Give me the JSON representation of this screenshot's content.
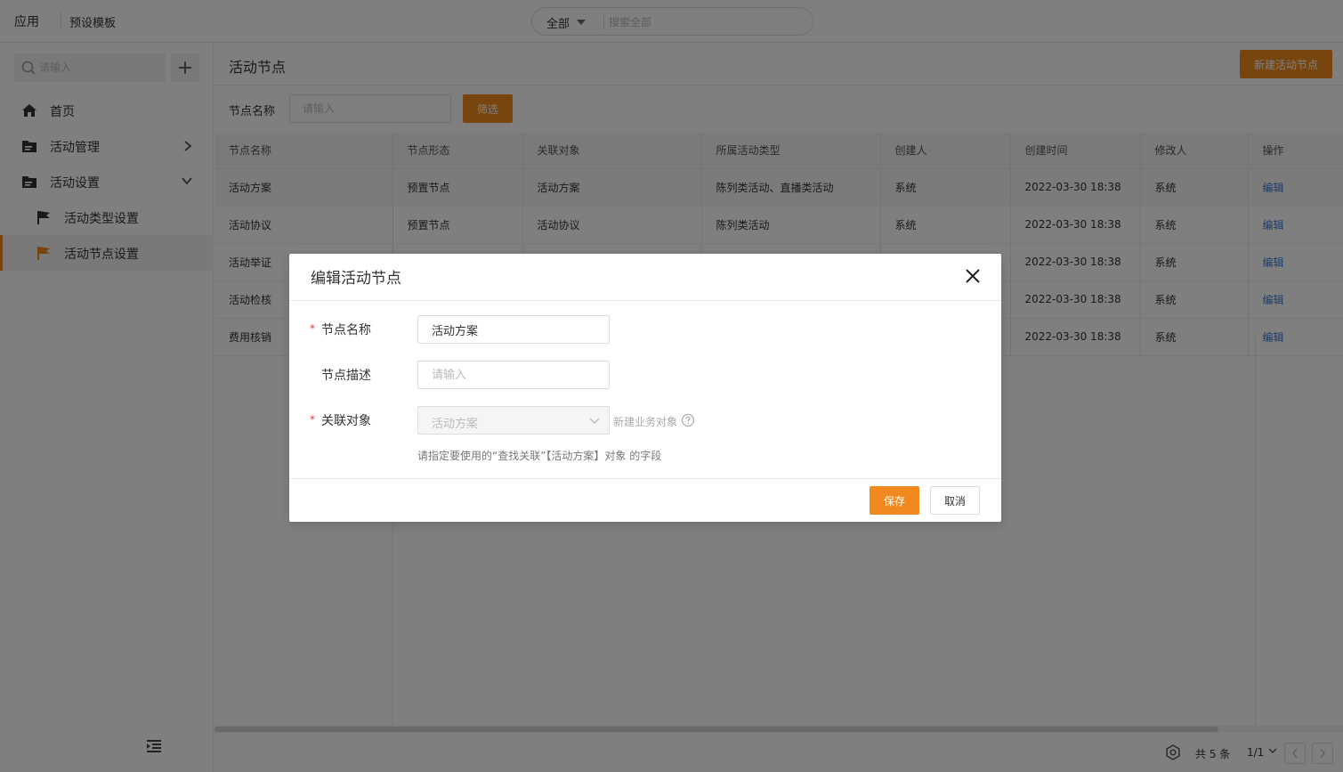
{
  "topbar": {
    "app_label": "应用",
    "template_label": "预设模板",
    "search_scope": "全部",
    "search_placeholder": "搜索全部"
  },
  "sidebar": {
    "search_placeholder": "请输入",
    "items": [
      {
        "label": "首页",
        "icon": "home-icon"
      },
      {
        "label": "活动管理",
        "icon": "folder-icon",
        "expandable": true,
        "expanded": false
      },
      {
        "label": "活动设置",
        "icon": "folder-icon",
        "expandable": true,
        "expanded": true
      },
      {
        "label": "活动类型设置",
        "icon": "flag-icon"
      },
      {
        "label": "活动节点设置",
        "icon": "flag-icon",
        "active": true
      }
    ]
  },
  "page": {
    "title": "活动节点",
    "new_button": "新建活动节点",
    "filter_label": "节点名称",
    "filter_placeholder": "请输入",
    "filter_button": "筛选"
  },
  "table": {
    "columns": [
      "节点名称",
      "节点形态",
      "关联对象",
      "所属活动类型",
      "创建人",
      "创建时间",
      "修改人",
      "操作"
    ],
    "rows": [
      [
        "活动方案",
        "预置节点",
        "活动方案",
        "陈列类活动、直播类活动",
        "系统",
        "2022-03-30 18:38",
        "系统",
        "编辑"
      ],
      [
        "活动协议",
        "预置节点",
        "活动协议",
        "陈列类活动",
        "系统",
        "2022-03-30 18:38",
        "系统",
        "编辑"
      ],
      [
        "活动举证",
        "",
        "",
        "",
        "",
        "2022-03-30 18:38",
        "系统",
        "编辑"
      ],
      [
        "活动检核",
        "",
        "",
        "",
        "",
        "2022-03-30 18:38",
        "系统",
        "编辑"
      ],
      [
        "费用核销",
        "",
        "",
        "",
        "",
        "2022-03-30 18:38",
        "系统",
        "编辑"
      ]
    ]
  },
  "pager": {
    "total": "共 5 条",
    "page": "1/1"
  },
  "modal": {
    "title": "编辑活动节点",
    "name_label": "节点名称",
    "name_value": "活动方案",
    "desc_label": "节点描述",
    "desc_placeholder": "请输入",
    "obj_label": "关联对象",
    "obj_value": "活动方案",
    "new_obj_link": "新建业务对象",
    "hint": "请指定要使用的“查找关联”【活动方案】对象 的字段",
    "required_mark": "*",
    "save_button": "保存",
    "cancel_button": "取消"
  },
  "colors": {
    "accent": "#f08a1e",
    "link": "#3a7bd5",
    "required": "#e4393c"
  }
}
